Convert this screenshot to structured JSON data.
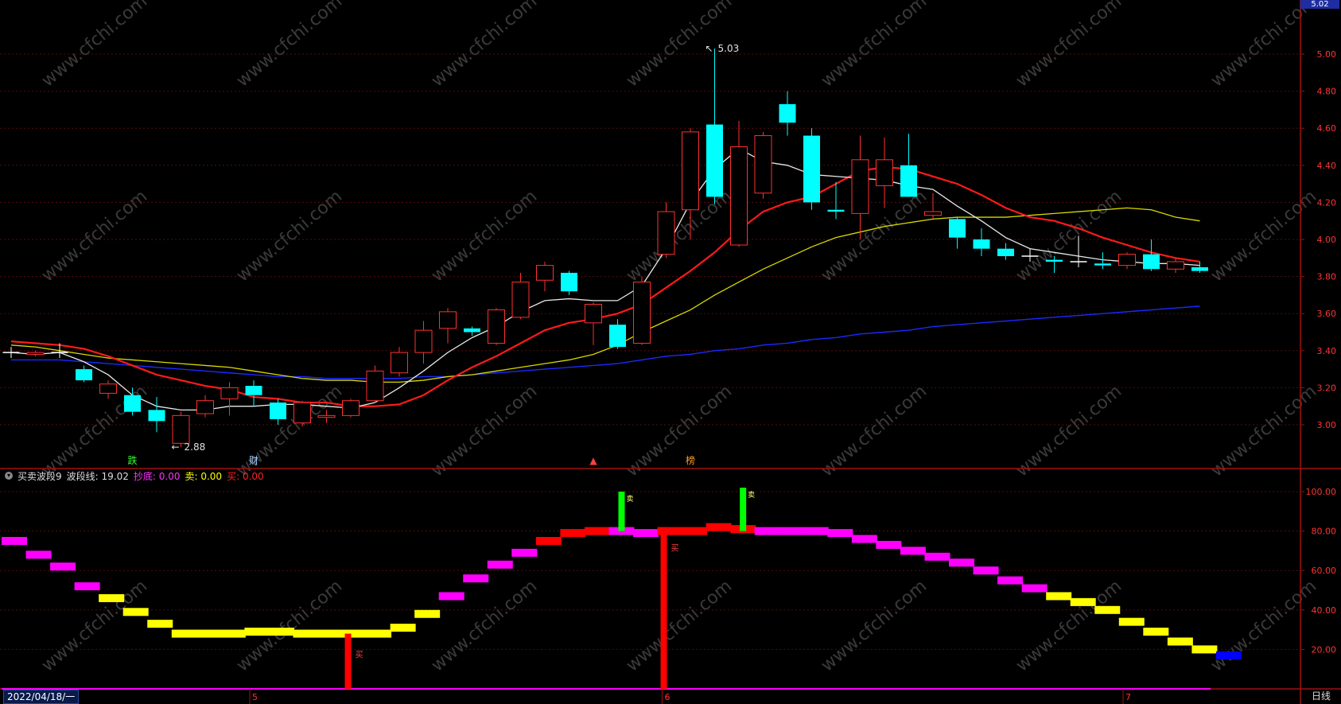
{
  "indicator": {
    "name": "买卖波段9",
    "line_label": "波段线:",
    "line_value": "19.02",
    "bottom_label": "抄底:",
    "bottom_value": "0.00",
    "sell_label": "卖:",
    "sell_value": "0.00",
    "buy_label": "买:",
    "buy_value": "0.00"
  },
  "date_label": "2022/04/18/一",
  "period_label": "日线",
  "price_tag": "5.02",
  "month_labels": [
    "5",
    "6",
    "7"
  ],
  "watermark": "www.cfchi.com",
  "colors": {
    "up": "#ff3030",
    "down": "#00ffff",
    "ma5": "#e8e8e8",
    "ma10": "#ff1a1a",
    "ma20": "#d8d800",
    "ma60": "#1a2aff",
    "axis": "#a01010",
    "magenta": "#ff00ff",
    "yellow": "#ffff00",
    "blue": "#0000ff",
    "green": "#00ff00"
  },
  "chart_data": [
    {
      "type": "candlestick",
      "ylim": [
        2.85,
        5.05
      ],
      "y_ticks": [
        "5.00",
        "4.80",
        "4.60",
        "4.40",
        "4.20",
        "4.00",
        "3.80",
        "3.60",
        "3.40",
        "3.20",
        "3.00"
      ],
      "candles": [
        {
          "o": 3.39,
          "h": 3.42,
          "l": 3.36,
          "c": 3.39
        },
        {
          "o": 3.38,
          "h": 3.4,
          "l": 3.37,
          "c": 3.39
        },
        {
          "o": 3.39,
          "h": 3.44,
          "l": 3.36,
          "c": 3.39
        },
        {
          "o": 3.3,
          "h": 3.32,
          "l": 3.23,
          "c": 3.24
        },
        {
          "o": 3.17,
          "h": 3.24,
          "l": 3.14,
          "c": 3.22
        },
        {
          "o": 3.16,
          "h": 3.2,
          "l": 3.05,
          "c": 3.07
        },
        {
          "o": 3.08,
          "h": 3.15,
          "l": 2.96,
          "c": 3.02
        },
        {
          "o": 2.9,
          "h": 3.07,
          "l": 2.88,
          "c": 3.05
        },
        {
          "o": 3.06,
          "h": 3.16,
          "l": 3.04,
          "c": 3.13
        },
        {
          "o": 3.14,
          "h": 3.23,
          "l": 3.05,
          "c": 3.2
        },
        {
          "o": 3.21,
          "h": 3.24,
          "l": 3.1,
          "c": 3.16
        },
        {
          "o": 3.12,
          "h": 3.14,
          "l": 3.0,
          "c": 3.03
        },
        {
          "o": 3.01,
          "h": 3.13,
          "l": 2.99,
          "c": 3.12
        },
        {
          "o": 3.04,
          "h": 3.08,
          "l": 3.01,
          "c": 3.05
        },
        {
          "o": 3.05,
          "h": 3.14,
          "l": 3.04,
          "c": 3.13
        },
        {
          "o": 3.13,
          "h": 3.32,
          "l": 3.12,
          "c": 3.29
        },
        {
          "o": 3.28,
          "h": 3.42,
          "l": 3.26,
          "c": 3.39
        },
        {
          "o": 3.39,
          "h": 3.56,
          "l": 3.33,
          "c": 3.51
        },
        {
          "o": 3.52,
          "h": 3.63,
          "l": 3.44,
          "c": 3.61
        },
        {
          "o": 3.52,
          "h": 3.53,
          "l": 3.48,
          "c": 3.5
        },
        {
          "o": 3.44,
          "h": 3.63,
          "l": 3.43,
          "c": 3.62
        },
        {
          "o": 3.58,
          "h": 3.82,
          "l": 3.57,
          "c": 3.77
        },
        {
          "o": 3.78,
          "h": 3.88,
          "l": 3.72,
          "c": 3.86
        },
        {
          "o": 3.82,
          "h": 3.83,
          "l": 3.7,
          "c": 3.72
        },
        {
          "o": 3.55,
          "h": 3.66,
          "l": 3.43,
          "c": 3.65
        },
        {
          "o": 3.54,
          "h": 3.57,
          "l": 3.41,
          "c": 3.42
        },
        {
          "o": 3.44,
          "h": 3.8,
          "l": 3.43,
          "c": 3.77
        },
        {
          "o": 3.92,
          "h": 4.2,
          "l": 3.9,
          "c": 4.15
        },
        {
          "o": 4.16,
          "h": 4.6,
          "l": 4.0,
          "c": 4.58
        },
        {
          "o": 4.62,
          "h": 5.03,
          "l": 4.19,
          "c": 4.23
        },
        {
          "o": 3.97,
          "h": 4.64,
          "l": 3.96,
          "c": 4.5
        },
        {
          "o": 4.25,
          "h": 4.58,
          "l": 4.22,
          "c": 4.56
        },
        {
          "o": 4.73,
          "h": 4.8,
          "l": 4.56,
          "c": 4.63
        },
        {
          "o": 4.56,
          "h": 4.6,
          "l": 4.16,
          "c": 4.2
        },
        {
          "o": 4.16,
          "h": 4.31,
          "l": 4.11,
          "c": 4.15
        },
        {
          "o": 4.14,
          "h": 4.56,
          "l": 4.0,
          "c": 4.43
        },
        {
          "o": 4.29,
          "h": 4.55,
          "l": 4.17,
          "c": 4.43
        },
        {
          "o": 4.4,
          "h": 4.57,
          "l": 4.23,
          "c": 4.23
        },
        {
          "o": 4.13,
          "h": 4.25,
          "l": 4.11,
          "c": 4.15
        },
        {
          "o": 4.11,
          "h": 4.12,
          "l": 3.95,
          "c": 4.01
        },
        {
          "o": 4.0,
          "h": 4.06,
          "l": 3.91,
          "c": 3.95
        },
        {
          "o": 3.95,
          "h": 3.98,
          "l": 3.89,
          "c": 3.91
        },
        {
          "o": 3.91,
          "h": 3.95,
          "l": 3.88,
          "c": 3.91
        },
        {
          "o": 3.89,
          "h": 3.91,
          "l": 3.82,
          "c": 3.88
        },
        {
          "o": 3.88,
          "h": 4.02,
          "l": 3.85,
          "c": 3.88
        },
        {
          "o": 3.87,
          "h": 3.93,
          "l": 3.84,
          "c": 3.86
        },
        {
          "o": 3.86,
          "h": 3.93,
          "l": 3.84,
          "c": 3.92
        },
        {
          "o": 3.92,
          "h": 4.0,
          "l": 3.83,
          "c": 3.84
        },
        {
          "o": 3.84,
          "h": 3.9,
          "l": 3.82,
          "c": 3.88
        },
        {
          "o": 3.85,
          "h": 3.88,
          "l": 3.82,
          "c": 3.83
        }
      ],
      "ma5": [
        3.39,
        3.38,
        3.39,
        3.34,
        3.27,
        3.16,
        3.1,
        3.08,
        3.08,
        3.1,
        3.1,
        3.11,
        3.11,
        3.1,
        3.09,
        3.12,
        3.2,
        3.29,
        3.39,
        3.47,
        3.53,
        3.61,
        3.67,
        3.68,
        3.67,
        3.67,
        3.75,
        3.95,
        4.2,
        4.38,
        4.49,
        4.42,
        4.4,
        4.35,
        4.34,
        4.33,
        4.32,
        4.29,
        4.27,
        4.18,
        4.1,
        4.01,
        3.95,
        3.93,
        3.91,
        3.89,
        3.88,
        3.87,
        3.87,
        3.86
      ],
      "ma10": [
        3.45,
        3.44,
        3.43,
        3.41,
        3.37,
        3.32,
        3.27,
        3.24,
        3.21,
        3.19,
        3.15,
        3.14,
        3.12,
        3.12,
        3.1,
        3.1,
        3.11,
        3.16,
        3.24,
        3.31,
        3.37,
        3.44,
        3.51,
        3.55,
        3.57,
        3.6,
        3.65,
        3.74,
        3.83,
        3.93,
        4.05,
        4.15,
        4.2,
        4.23,
        4.3,
        4.37,
        4.39,
        4.38,
        4.34,
        4.3,
        4.24,
        4.17,
        4.12,
        4.1,
        4.06,
        4.01,
        3.97,
        3.93,
        3.9,
        3.88
      ],
      "ma20": [
        3.43,
        3.42,
        3.4,
        3.38,
        3.36,
        3.35,
        3.34,
        3.33,
        3.32,
        3.31,
        3.29,
        3.27,
        3.25,
        3.24,
        3.24,
        3.23,
        3.23,
        3.24,
        3.26,
        3.27,
        3.29,
        3.31,
        3.33,
        3.35,
        3.38,
        3.43,
        3.5,
        3.56,
        3.62,
        3.7,
        3.77,
        3.84,
        3.9,
        3.96,
        4.01,
        4.04,
        4.07,
        4.09,
        4.11,
        4.12,
        4.12,
        4.12,
        4.13,
        4.14,
        4.15,
        4.16,
        4.17,
        4.16,
        4.12,
        4.1
      ],
      "ma60": [
        3.35,
        3.35,
        3.35,
        3.34,
        3.33,
        3.32,
        3.31,
        3.3,
        3.29,
        3.28,
        3.27,
        3.26,
        3.26,
        3.25,
        3.25,
        3.25,
        3.25,
        3.26,
        3.26,
        3.27,
        3.28,
        3.29,
        3.3,
        3.31,
        3.32,
        3.33,
        3.35,
        3.37,
        3.38,
        3.4,
        3.41,
        3.43,
        3.44,
        3.46,
        3.47,
        3.49,
        3.5,
        3.51,
        3.53,
        3.54,
        3.55,
        3.56,
        3.57,
        3.58,
        3.59,
        3.6,
        3.61,
        3.62,
        3.63,
        3.64
      ],
      "annotations": [
        {
          "text": "5.03",
          "index": 29,
          "price": 5.03
        },
        {
          "text": "2.88",
          "index": 7,
          "price": 2.88
        }
      ],
      "markers": [
        {
          "text": "跌",
          "index": 5,
          "color": "#33ff33"
        },
        {
          "text": "财",
          "index": 10,
          "color": "#9fcfff"
        },
        {
          "text": "▲",
          "index": 24,
          "color": "#ff4040"
        },
        {
          "text": "榜",
          "index": 28,
          "color": "#ff9a20"
        }
      ]
    },
    {
      "type": "bar",
      "ylim": [
        0,
        110
      ],
      "y_ticks": [
        "100.00",
        "80.00",
        "60.00",
        "40.00",
        "20.00"
      ],
      "band_values": [
        75,
        68,
        62,
        52,
        46,
        39,
        33,
        28,
        28,
        28,
        29,
        29,
        28,
        28,
        28,
        28,
        31,
        38,
        47,
        56,
        63,
        69,
        75,
        79,
        80,
        80,
        79,
        80,
        80,
        82,
        81,
        80,
        80,
        80,
        79,
        76,
        73,
        70,
        67,
        64,
        60,
        55,
        51,
        47,
        44,
        40,
        34,
        29,
        24,
        20,
        17
      ],
      "band_colors": [
        "m",
        "m",
        "m",
        "m",
        "y",
        "y",
        "y",
        "y",
        "y",
        "y",
        "y",
        "y",
        "y",
        "y",
        "y",
        "y",
        "y",
        "y",
        "m",
        "m",
        "m",
        "m",
        "r",
        "r",
        "r",
        "m",
        "m",
        "r",
        "r",
        "r",
        "r",
        "m",
        "m",
        "m",
        "m",
        "m",
        "m",
        "m",
        "m",
        "m",
        "m",
        "m",
        "m",
        "y",
        "y",
        "y",
        "y",
        "y",
        "y",
        "y",
        "b"
      ],
      "buy_signals": [
        {
          "index": 14,
          "value": 28,
          "text": "买"
        },
        {
          "index": 27,
          "value": 82,
          "text": "买"
        }
      ],
      "sell_signals": [
        {
          "index": 25,
          "value": 100,
          "text": "卖"
        },
        {
          "index": 30,
          "value": 102,
          "text": "卖"
        }
      ],
      "bottom_line_value": 0
    }
  ]
}
